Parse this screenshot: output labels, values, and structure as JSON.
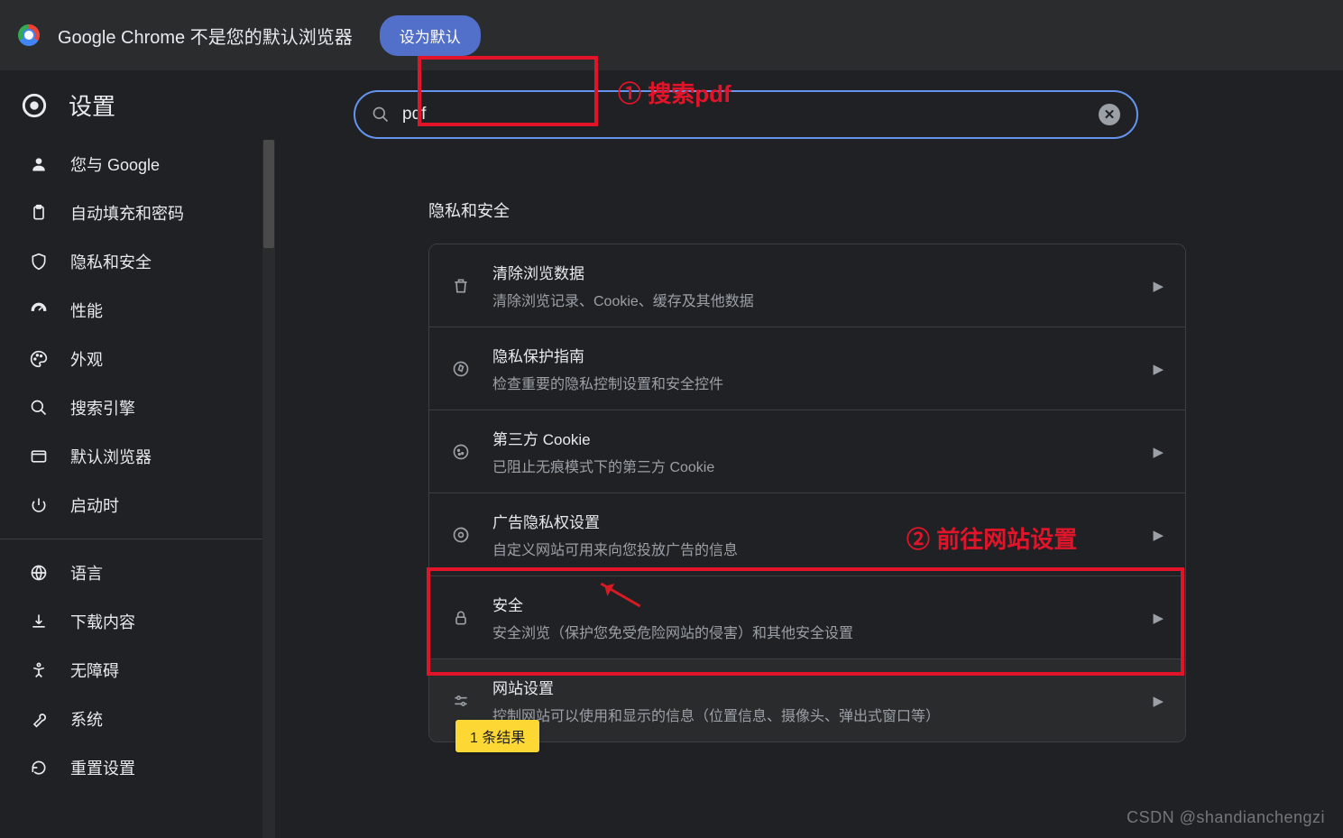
{
  "banner": {
    "message": "Google Chrome 不是您的默认浏览器",
    "button": "设为默认"
  },
  "sidebar": {
    "title": "设置",
    "items": [
      {
        "label": "您与 Google",
        "icon": "person"
      },
      {
        "label": "自动填充和密码",
        "icon": "clipboard"
      },
      {
        "label": "隐私和安全",
        "icon": "shield"
      },
      {
        "label": "性能",
        "icon": "speed"
      },
      {
        "label": "外观",
        "icon": "palette"
      },
      {
        "label": "搜索引擎",
        "icon": "search"
      },
      {
        "label": "默认浏览器",
        "icon": "browser"
      },
      {
        "label": "启动时",
        "icon": "power"
      }
    ],
    "items2": [
      {
        "label": "语言",
        "icon": "globe"
      },
      {
        "label": "下载内容",
        "icon": "download"
      },
      {
        "label": "无障碍",
        "icon": "accessibility"
      },
      {
        "label": "系统",
        "icon": "wrench"
      },
      {
        "label": "重置设置",
        "icon": "reset"
      }
    ]
  },
  "search": {
    "value": "pdf",
    "placeholder": ""
  },
  "main": {
    "section": "隐私和安全",
    "rows": [
      {
        "title": "清除浏览数据",
        "sub": "清除浏览记录、Cookie、缓存及其他数据",
        "icon": "trash"
      },
      {
        "title": "隐私保护指南",
        "sub": "检查重要的隐私控制设置和安全控件",
        "icon": "compass"
      },
      {
        "title": "第三方 Cookie",
        "sub": "已阻止无痕模式下的第三方 Cookie",
        "icon": "cookie"
      },
      {
        "title": "广告隐私权设置",
        "sub": "自定义网站可用来向您投放广告的信息",
        "icon": "ads"
      },
      {
        "title": "安全",
        "sub": "安全浏览（保护您免受危险网站的侵害）和其他安全设置",
        "icon": "lock"
      },
      {
        "title": "网站设置",
        "sub": "控制网站可以使用和显示的信息（位置信息、摄像头、弹出式窗口等）",
        "icon": "sliders"
      }
    ],
    "result_tooltip": "1 条结果"
  },
  "annotations": {
    "step1": "① 搜索pdf",
    "step2": "② 前往网站设置"
  },
  "watermark": "CSDN @shandianchengzi",
  "colors": {
    "accent": "#6494ed",
    "annotation": "#e2142a",
    "tooltip": "#fdd835"
  }
}
